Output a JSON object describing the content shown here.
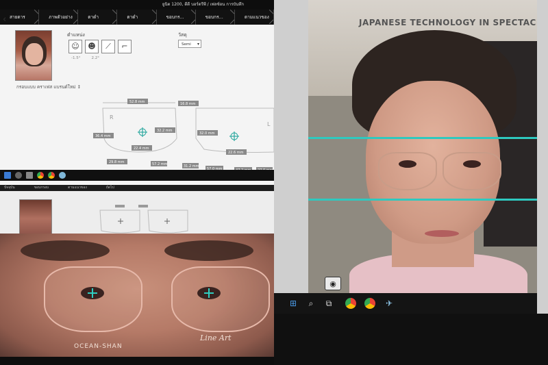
{
  "top_left": {
    "window_title": "ยูนิต 1200, ดีดี บอร์ดรีพี / เฟลซ์อน  การบันทึก",
    "steps": [
      "สายตาร",
      "ภาพตัวอย่าง",
      "ตาดำ",
      "ตาดำ",
      "ขอบกร...",
      "ขอบกร...",
      "ตามแนวของ"
    ],
    "caption": "กรอบแบบ  คราเฟส แบรนด์ใหม่  ↕",
    "position_label": "ตำแหน่ง",
    "position_values": [
      "-1.5°",
      "2.2°"
    ],
    "material_label": "วัสดุ",
    "material_value": "Semi",
    "measurements": {
      "width_left": "52.8 mm",
      "bridge": "16.8 mm",
      "width_right": "52.8 mm",
      "pd_left": "32.2 mm",
      "pd_right": "32.0 mm",
      "height_left": "22.4 mm",
      "height_right": "22.6 mm",
      "side_left": "36.4 mm",
      "bottom_a": "29.8 mm",
      "bottom_b": "57.2 mm",
      "bottom_c": "31.2 mm",
      "bottom_d": "57.0 mm",
      "bottom_e": "47.2 mm",
      "bottom_f": "27.0 mm",
      "label_r": "R",
      "label_l": "L"
    }
  },
  "bottom_left": {
    "strip_items": [
      "ปัจจุบัน",
      "ขอบกรอบ",
      "ตามแนวของ",
      "ถัดไป"
    ],
    "brand_left": "OCEAN-SHAN",
    "brand_right": "Line Art"
  },
  "right": {
    "banner": "JAPANESE TECHNOLOGY IN SPECTACLE LENSES",
    "guide_color": "#2ec9bf"
  }
}
